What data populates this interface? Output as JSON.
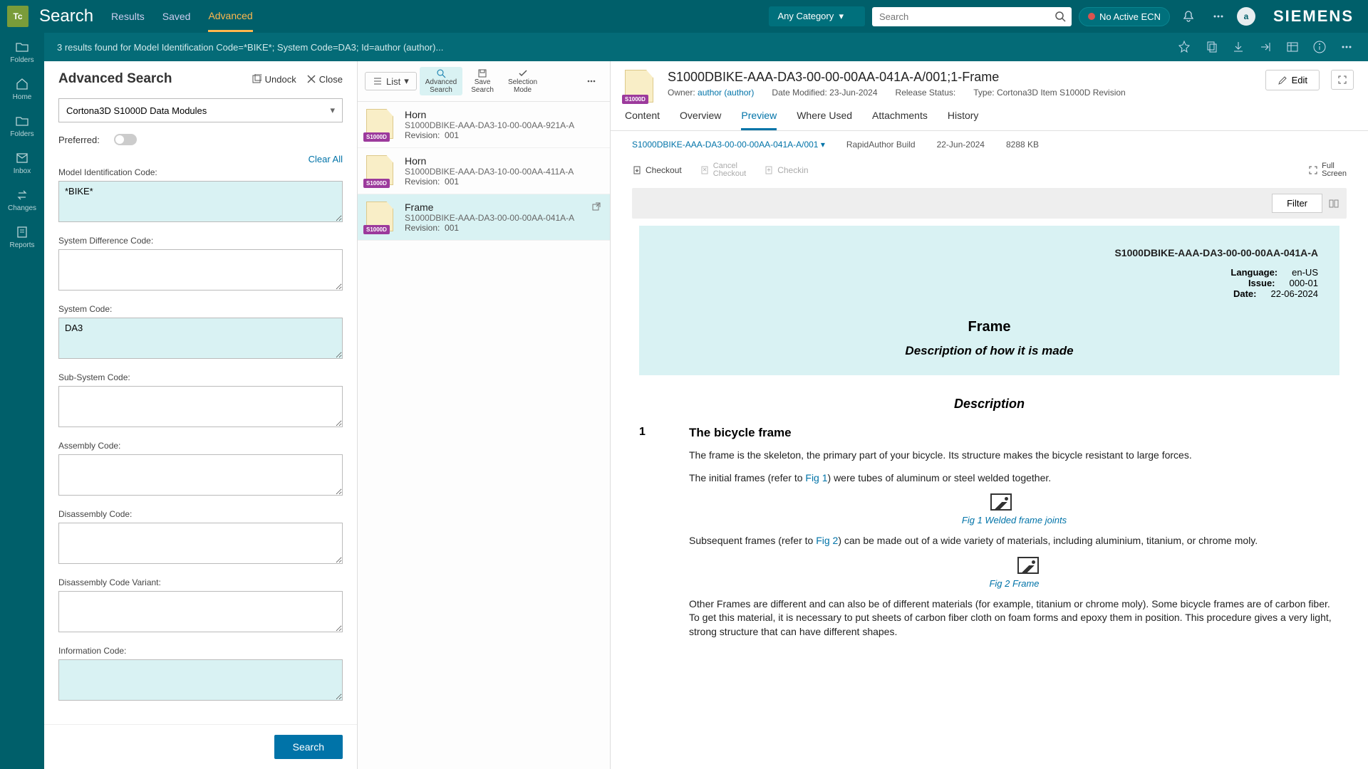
{
  "header": {
    "app_title": "Search",
    "tabs": [
      "Results",
      "Saved",
      "Advanced"
    ],
    "active_tab": 2,
    "category": "Any Category",
    "search_placeholder": "Search",
    "no_ecn": "No Active ECN",
    "avatar": "a",
    "brand": "SIEMENS"
  },
  "sub_header": {
    "summary": "3 results found for Model Identification Code=*BIKE*; System Code=DA3; Id=author (author)..."
  },
  "rail": [
    {
      "label": "Folders"
    },
    {
      "label": "Home"
    },
    {
      "label": "Folders"
    },
    {
      "label": "Inbox"
    },
    {
      "label": "Changes"
    },
    {
      "label": "Reports"
    }
  ],
  "adv": {
    "title": "Advanced Search",
    "undock": "Undock",
    "close": "Close",
    "type_select": "Cortona3D S1000D Data Modules",
    "preferred": "Preferred:",
    "clear_all": "Clear All",
    "search_btn": "Search",
    "fields": [
      {
        "label": "Model Identification Code:",
        "value": "*BIKE*",
        "filled": true
      },
      {
        "label": "System Difference Code:",
        "value": "",
        "filled": false
      },
      {
        "label": "System Code:",
        "value": "DA3",
        "filled": true
      },
      {
        "label": "Sub-System Code:",
        "value": "",
        "filled": false
      },
      {
        "label": "Assembly Code:",
        "value": "",
        "filled": false
      },
      {
        "label": "Disassembly Code:",
        "value": "",
        "filled": false
      },
      {
        "label": "Disassembly Code Variant:",
        "value": "",
        "filled": false
      },
      {
        "label": "Information Code:",
        "value": "",
        "filled": true
      }
    ]
  },
  "results_toolbar": {
    "list": "List",
    "adv_search": "Advanced Search",
    "save_search": "Save Search",
    "sel_mode": "Selection Mode"
  },
  "results": [
    {
      "title": "Horn",
      "dmc": "S1000DBIKE-AAA-DA3-10-00-00AA-921A-A",
      "rev_label": "Revision:",
      "rev": "001",
      "badge": "S1000D"
    },
    {
      "title": "Horn",
      "dmc": "S1000DBIKE-AAA-DA3-10-00-00AA-411A-A",
      "rev_label": "Revision:",
      "rev": "001",
      "badge": "S1000D"
    },
    {
      "title": "Frame",
      "dmc": "S1000DBIKE-AAA-DA3-00-00-00AA-041A-A",
      "rev_label": "Revision:",
      "rev": "001",
      "badge": "S1000D",
      "selected": true
    }
  ],
  "detail": {
    "badge": "S1000D",
    "title": "S1000DBIKE-AAA-DA3-00-00-00AA-041A-A/001;1-Frame",
    "owner_label": "Owner:",
    "owner": "author (author)",
    "modified_label": "Date Modified:",
    "modified": "23-Jun-2024",
    "release_label": "Release Status:",
    "type_label": "Type:",
    "type": "Cortona3D Item S1000D Revision",
    "edit": "Edit",
    "tabs": [
      "Content",
      "Overview",
      "Preview",
      "Where Used",
      "Attachments",
      "History"
    ],
    "active_tab": 2,
    "rev_code": "S1000DBIKE-AAA-DA3-00-00-00AA-041A-A/001",
    "build": "RapidAuthor Build",
    "build_date": "22-Jun-2024",
    "size": "8288 KB",
    "actions": {
      "checkout": "Checkout",
      "cancel": "Cancel Checkout",
      "checkin": "Checkin",
      "fullscreen": "Full Screen"
    },
    "filter": "Filter"
  },
  "doc": {
    "code": "S1000DBIKE-AAA-DA3-00-00-00AA-041A-A",
    "lang_label": "Language:",
    "lang": "en-US",
    "issue_label": "Issue:",
    "issue": "000-01",
    "date_label": "Date:",
    "date": "22-06-2024",
    "h1": "Frame",
    "h2": "Description of how it is made",
    "desc_heading": "Description",
    "sec_num": "1",
    "sec_title": "The bicycle frame",
    "p1a": "The frame is the skeleton, the primary part of your bicycle. Its structure makes the bicycle resistant to large forces.",
    "p2a": "The initial frames (refer to ",
    "p2link": "Fig 1",
    "p2b": ") were tubes of aluminum or steel welded together.",
    "fig1_caption": "Fig 1 Welded frame joints",
    "p3a": "Subsequent frames (refer to ",
    "p3link": "Fig 2",
    "p3b": ") can be made out of a wide variety of materials, including aluminium, titanium, or chrome moly.",
    "fig2_caption": "Fig 2 Frame",
    "p4": "Other Frames are different and can also be of different materials (for example, titanium or chrome moly). Some bicycle frames are of carbon fiber. To get this material, it is necessary to put sheets of carbon fiber cloth on foam forms and epoxy them in position. This procedure gives a very light, strong structure that can have different shapes."
  }
}
